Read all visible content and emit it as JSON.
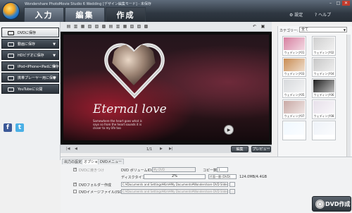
{
  "window": {
    "title": "Wondershare PhotoMovie Studio 6 Wedding [デザイン編集モード] - 未保存",
    "min": "–",
    "max": "□",
    "close": "✕"
  },
  "header": {
    "tabs": [
      {
        "label": "入力"
      },
      {
        "label": "編集"
      },
      {
        "label": "作成"
      }
    ],
    "settings": "⚙ 設定",
    "help": "? ヘルプ"
  },
  "sidebar": {
    "items": [
      {
        "label": "DVDに保存",
        "active": true
      },
      {
        "label": "動画に保存",
        "arrow": "▼"
      },
      {
        "label": "HDビデオに保存",
        "arrow": "▼"
      },
      {
        "label": "iPod•iPhone•iPadに保存",
        "arrow": "▼"
      },
      {
        "label": "携帯プレーヤー用に保存",
        "arrow": "▼"
      },
      {
        "label": "YouTubeに公開"
      }
    ],
    "facebook": "f",
    "twitter": "t"
  },
  "preview": {
    "title_text": "Eternal love",
    "lyric": "Somewhere the heart goes what is\nsays so from the heart sounds it is\ncloser to my life too",
    "page": "1/1",
    "edit_label": "編集",
    "preview_label": "プレビュー"
  },
  "category": {
    "label": "カテゴリー:",
    "selected": "全て",
    "thumbs": [
      "ウェディング01",
      "ウェディング02",
      "ウェディング03",
      "ウェディング04",
      "ウェディング05",
      "ウェディング06",
      "ウェディング07",
      "ウェディング08",
      "",
      ""
    ],
    "thumb_colors": [
      "#d67fa0",
      "#cfcfcf",
      "#c88c52",
      "#c7c7c7",
      "#d7d9dc",
      "#1f1f1f",
      "#c8a8a4",
      "#e7e0ea",
      "#f0f8ff",
      "#eef2f8"
    ]
  },
  "bottom": {
    "tabs": [
      "出力の設定",
      "オプション",
      "DVDメニュー"
    ],
    "dvd_burn": "DVDに焼きつけ",
    "dvd_volume_label": "DVD ボリュームID:",
    "dvd_volume_value": "My DVD",
    "copies_label": "コピー数:",
    "copies_value": "1",
    "disc_type_label": "ディスクタイプ:",
    "progress_percent": "2%",
    "disc_type_value": "片面一層 (DVD)",
    "capacity": "124.0MB/4.4GB",
    "folder_label": "DVDフォルダー作成",
    "folder_path": "C:¥Documents and Settings¥Kim¥My Documents¥Wondershare DVD Slideshow",
    "iso_label": "DVDイメージファイル(ISO)作成",
    "iso_path": "C:¥Documents and Settings¥Kim¥My Documents¥Wondershare DVD Slideshow",
    "browse": "...",
    "create_button": "DVD作成"
  }
}
